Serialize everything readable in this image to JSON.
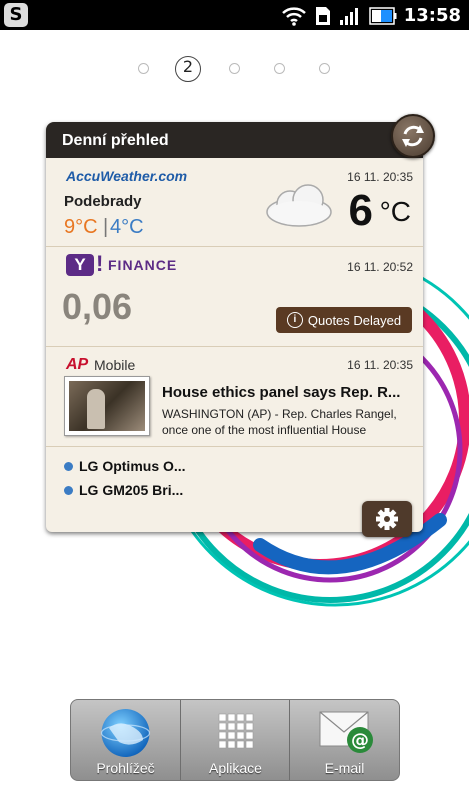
{
  "status_bar": {
    "app_icon_label": "S",
    "time": "13:58"
  },
  "pager": {
    "current_page": "2"
  },
  "widget": {
    "title": "Denní přehled",
    "weather": {
      "provider": "AccuWeather.com",
      "timestamp": "16 11. 20:35",
      "city": "Podebrady",
      "high": "9°C",
      "low": "4°C",
      "temperature": "6",
      "unit": "°C"
    },
    "finance": {
      "provider_mark": "Y",
      "provider_bang": "!",
      "provider_word": "FINANCE",
      "timestamp": "16 11. 20:52",
      "value": "0,06",
      "quotes_delayed_label": "Quotes Delayed"
    },
    "news": {
      "provider_ap": "AP",
      "provider_mobile": "Mobile",
      "timestamp": "16 11. 20:35",
      "headline": "House ethics panel says Rep. R...",
      "snippet": "WASHINGTON (AP) - Rep. Charles Rangel, once one of the most influential House"
    },
    "feeds": [
      "LG Optimus O...",
      "LG GM205 Bri..."
    ]
  },
  "dock": {
    "items": [
      {
        "label": "Prohlížeč",
        "icon": "globe-icon"
      },
      {
        "label": "Aplikace",
        "icon": "apps-grid-icon"
      },
      {
        "label": "E-mail",
        "icon": "email-icon"
      }
    ]
  },
  "colors": {
    "accent_orange": "#e87722",
    "accent_blue": "#3b7cc4",
    "yahoo_purple": "#5c2b86",
    "ap_red": "#c8102e",
    "widget_brown": "#5a3a23"
  }
}
